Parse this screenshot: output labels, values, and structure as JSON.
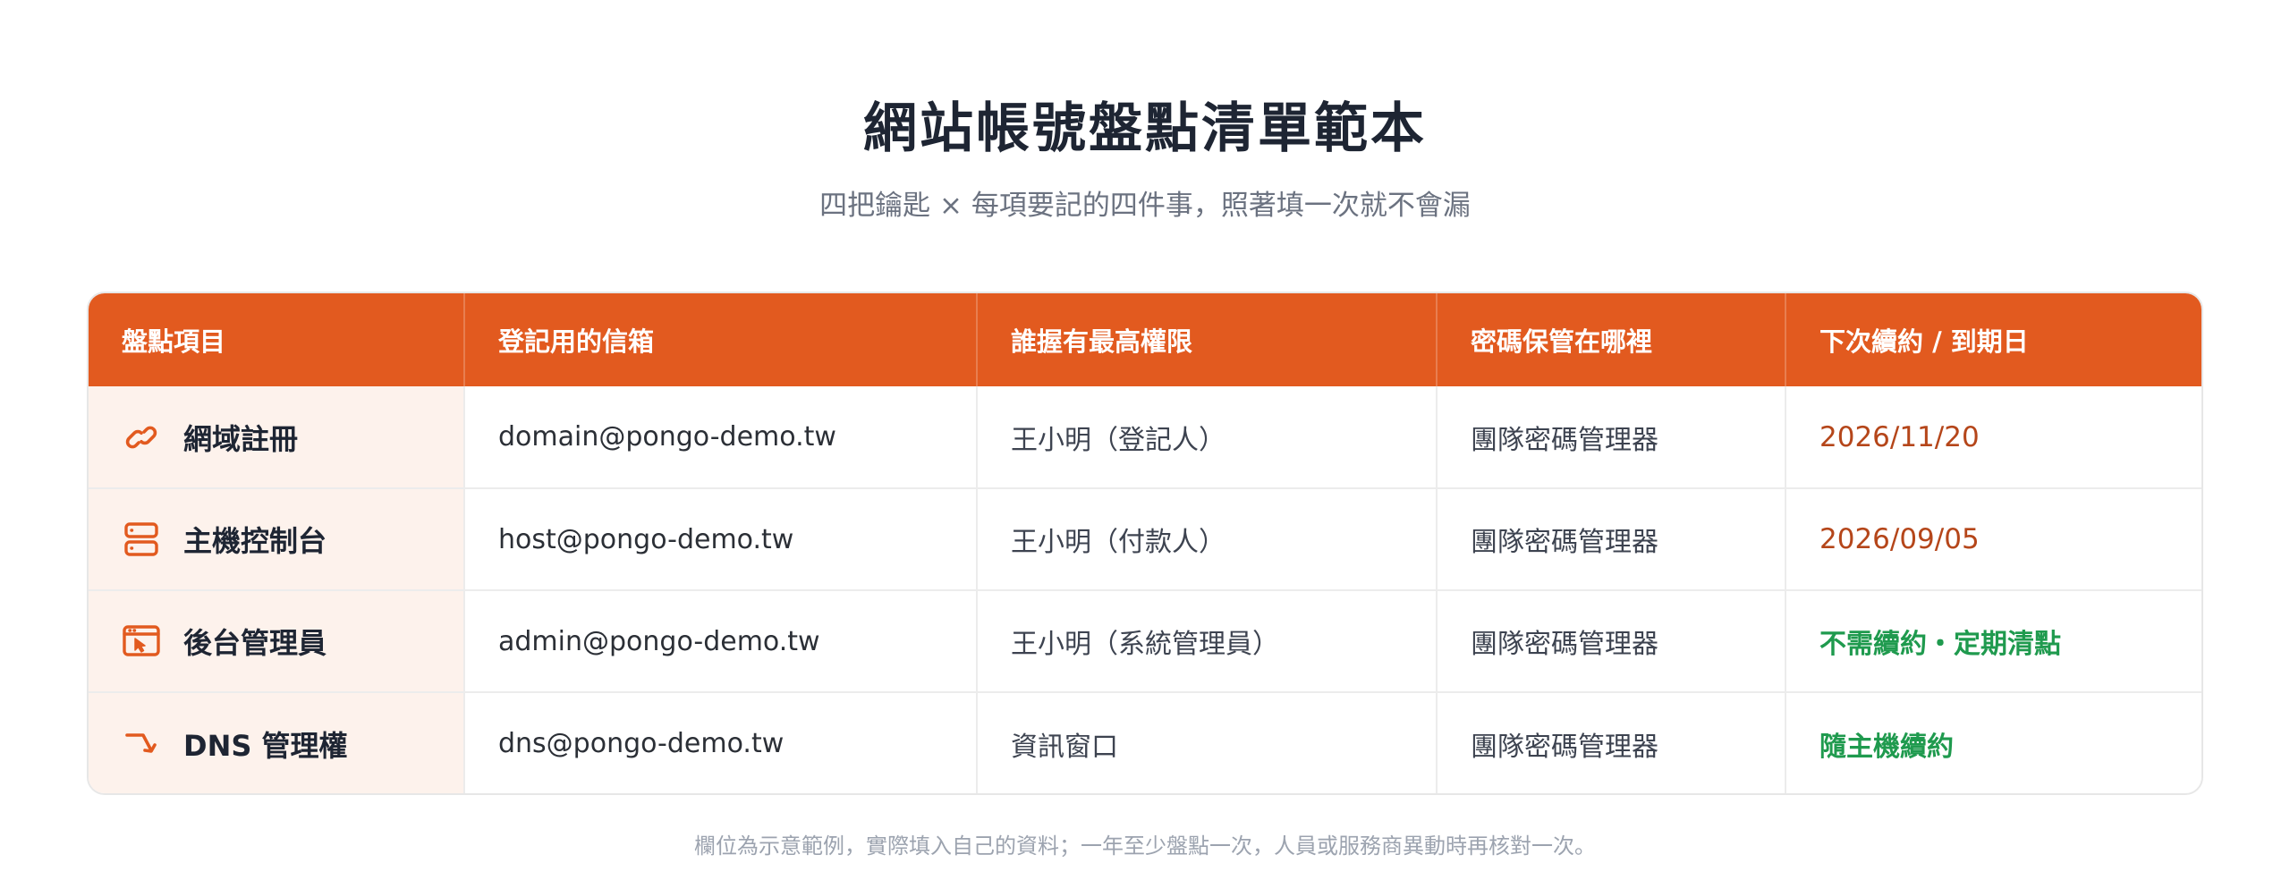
{
  "page": {
    "title": "網站帳號盤點清單範本",
    "subtitle": "四把鑰匙 × 每項要記的四件事，照著填一次就不會漏",
    "footnote": "欄位為示意範例，實際填入自己的資料；一年至少盤點一次，人員或服務商異動時再核對一次。"
  },
  "colors": {
    "accent": "#e25a1f",
    "warn": "#b5461a",
    "ok": "#1f9a4e",
    "item_bg": "#fdf2ec"
  },
  "table": {
    "headers": [
      "盤點項目",
      "登記用的信箱",
      "誰握有最高權限",
      "密碼保管在哪裡",
      "下次續約 / 到期日"
    ],
    "rows": [
      {
        "icon": "link-icon",
        "item": "網域註冊",
        "email": "domain@pongo-demo.tw",
        "owner": "王小明（登記人）",
        "password": "團隊密碼管理器",
        "renewal": "2026/11/20",
        "renewal_status": "warn"
      },
      {
        "icon": "server-icon",
        "item": "主機控制台",
        "email": "host@pongo-demo.tw",
        "owner": "王小明（付款人）",
        "password": "團隊密碼管理器",
        "renewal": "2026/09/05",
        "renewal_status": "warn"
      },
      {
        "icon": "admin-window-icon",
        "item": "後台管理員",
        "email": "admin@pongo-demo.tw",
        "owner": "王小明（系統管理員）",
        "password": "團隊密碼管理器",
        "renewal": "不需續約・定期清點",
        "renewal_status": "ok"
      },
      {
        "icon": "redirect-arrow-icon",
        "item": "DNS 管理權",
        "email": "dns@pongo-demo.tw",
        "owner": "資訊窗口",
        "password": "團隊密碼管理器",
        "renewal": "隨主機續約",
        "renewal_status": "ok"
      }
    ]
  }
}
